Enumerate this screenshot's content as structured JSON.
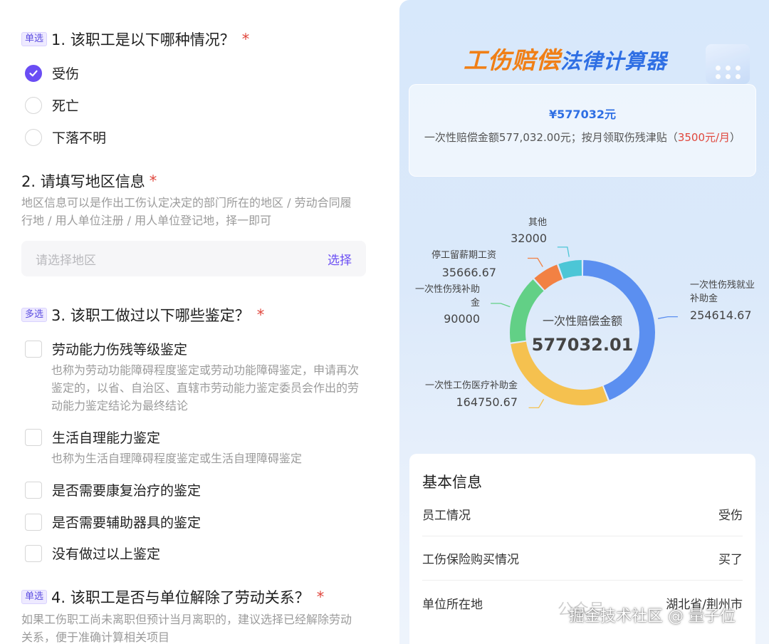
{
  "form": {
    "q1": {
      "tag": "单选",
      "title": "1. 该职工是以下哪种情况？",
      "req": "*",
      "options": [
        {
          "label": "受伤",
          "selected": true
        },
        {
          "label": "死亡",
          "selected": false
        },
        {
          "label": "下落不明",
          "selected": false
        }
      ]
    },
    "q2": {
      "title": "2. 请填写地区信息",
      "req": "*",
      "desc": "地区信息可以是作出工伤认定决定的部门所在的地区 / 劳动合同履行地 / 用人单位注册 / 用人单位登记地，择一即可",
      "placeholder": "请选择地区",
      "button": "选择"
    },
    "q3": {
      "tag": "多选",
      "title": "3. 该职工做过以下哪些鉴定？",
      "req": "*",
      "options": [
        {
          "label": "劳动能力伤残等级鉴定",
          "desc": "也称为劳动功能障碍程度鉴定或劳动功能障碍鉴定，申请再次鉴定的，以省、自治区、直辖市劳动能力鉴定委员会作出的劳动能力鉴定结论为最终结论"
        },
        {
          "label": "生活自理能力鉴定",
          "desc": "也称为生活自理障碍程度鉴定或生活自理障碍鉴定"
        },
        {
          "label": "是否需要康复治疗的鉴定"
        },
        {
          "label": "是否需要辅助器具的鉴定"
        },
        {
          "label": "没有做过以上鉴定"
        }
      ]
    },
    "q4": {
      "tag": "单选",
      "title": "4. 该职工是否与单位解除了劳动关系？",
      "req": "*",
      "desc": "如果工伤职工尚未离职但预计当月离职的，建议选择已经解除劳动关系，便于准确计算相关项目"
    }
  },
  "calc": {
    "title_part1": "工伤赔偿",
    "title_part2": "法律计算器",
    "result_amount": "¥577032元",
    "result_text_1": "一次性赔偿金额577,032.00元；按月领取伤残津贴（",
    "result_text_red": "3500元/月",
    "result_text_2": "）",
    "info": {
      "title": "基本信息",
      "rows": [
        {
          "key": "员工情况",
          "value": "受伤"
        },
        {
          "key": "工伤保险购买情况",
          "value": "买了"
        },
        {
          "key": "单位所在地",
          "value": "湖北省/荆州市"
        }
      ]
    },
    "watermark": "掘金技术社区 @ 量子位",
    "watermark_faint": "公众号"
  },
  "chart_data": {
    "type": "pie",
    "center_label": "一次性赔偿金额",
    "center_value": "577032.01",
    "slices": [
      {
        "label": "一次性伤残就业补助金",
        "value": 254614.67,
        "display": "254614.67",
        "color": "#5b8ff0"
      },
      {
        "label": "一次性工伤医疗补助金",
        "value": 164750.67,
        "display": "164750.67",
        "color": "#f5c14f"
      },
      {
        "label": "一次性伤残补助金",
        "value": 90000,
        "display": "90000",
        "color": "#62d086"
      },
      {
        "label": "停工留薪期工资",
        "value": 35666.67,
        "display": "35666.67",
        "color": "#f28143"
      },
      {
        "label": "其他",
        "value": 32000,
        "display": "32000",
        "color": "#4cc6d6"
      }
    ]
  }
}
